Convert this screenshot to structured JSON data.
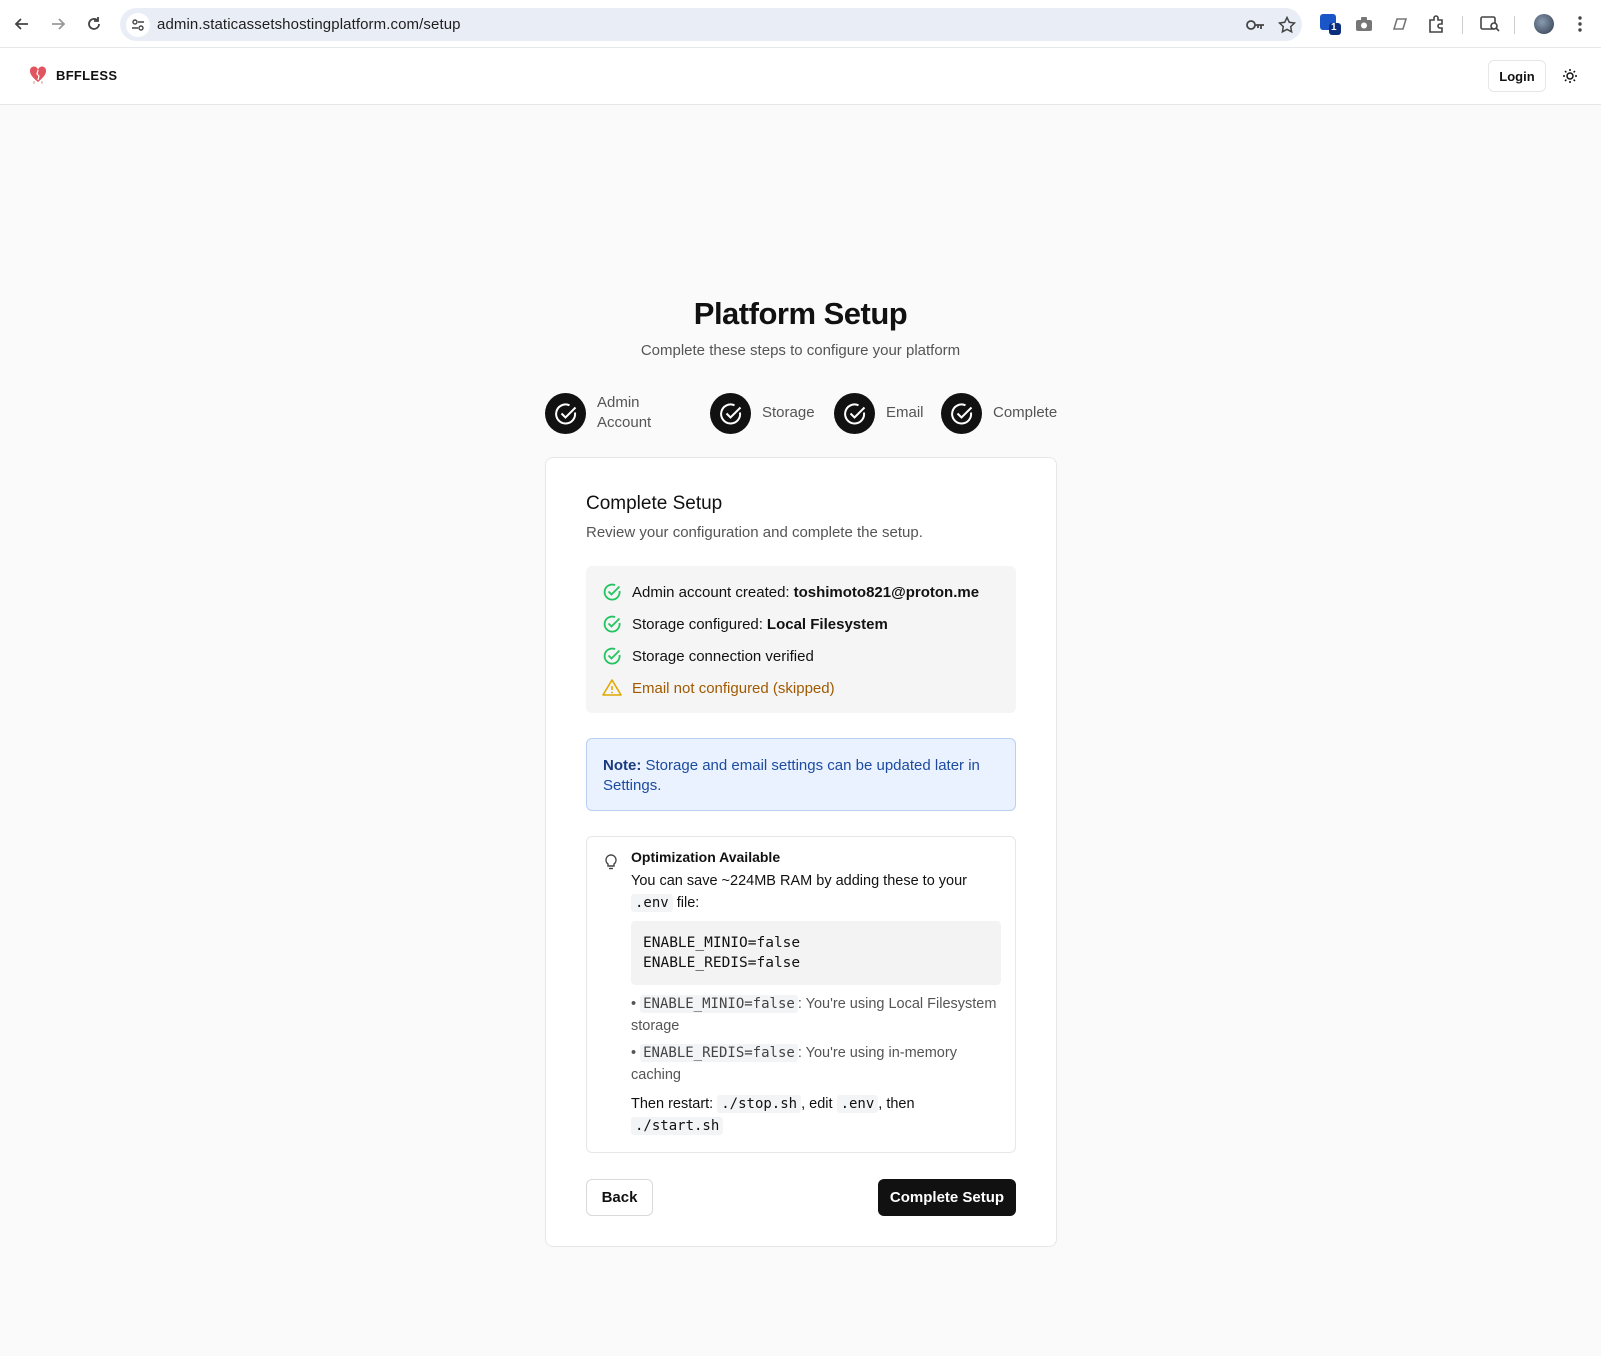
{
  "browser": {
    "url": "admin.staticassetshostingplatform.com/setup",
    "extension_badge": "1"
  },
  "app": {
    "brand": "BFFLESS",
    "login_label": "Login"
  },
  "page": {
    "title": "Platform Setup",
    "subtitle": "Complete these steps to configure your platform"
  },
  "steps": [
    {
      "label_line1": "Admin",
      "label_line2": "Account",
      "status": "done"
    },
    {
      "label": "Storage",
      "status": "done"
    },
    {
      "label": "Email",
      "status": "done"
    },
    {
      "label": "Complete",
      "status": "done"
    }
  ],
  "card": {
    "title": "Complete Setup",
    "description": "Review your configuration and complete the setup.",
    "summary": [
      {
        "text": "Admin account created:",
        "value": "toshimoto821@proton.me",
        "status": "success"
      },
      {
        "text": "Storage configured:",
        "value": "Local Filesystem",
        "status": "success"
      },
      {
        "text": "Storage connection verified",
        "value": "",
        "status": "success"
      },
      {
        "text": "Email not configured (skipped)",
        "value": "",
        "status": "warning"
      }
    ],
    "note": {
      "label": "Note:",
      "text": "Storage and email settings can be updated later in Settings."
    },
    "optimization": {
      "title": "Optimization Available",
      "text_before": "You can save ~224MB RAM by adding these to your",
      "env_file": ".env",
      "text_after": "file:",
      "code": "ENABLE_MINIO=false\nENABLE_REDIS=false",
      "bullets": [
        {
          "code": "ENABLE_MINIO=false",
          "text": ": You're using Local Filesystem storage"
        },
        {
          "code": "ENABLE_REDIS=false",
          "text": ": You're using in-memory caching"
        }
      ],
      "restart_prefix": "Then restart:",
      "restart_stop": "./stop.sh",
      "restart_edit": ", edit",
      "restart_env": ".env",
      "restart_then": ", then",
      "restart_start": "./start.sh"
    },
    "back_label": "Back",
    "complete_label": "Complete Setup"
  },
  "colors": {
    "success": "#22c55e",
    "warning": "#e0a800",
    "primary": "#111111",
    "note_bg": "#eaf2ff",
    "note_text": "#1d4ba0"
  }
}
